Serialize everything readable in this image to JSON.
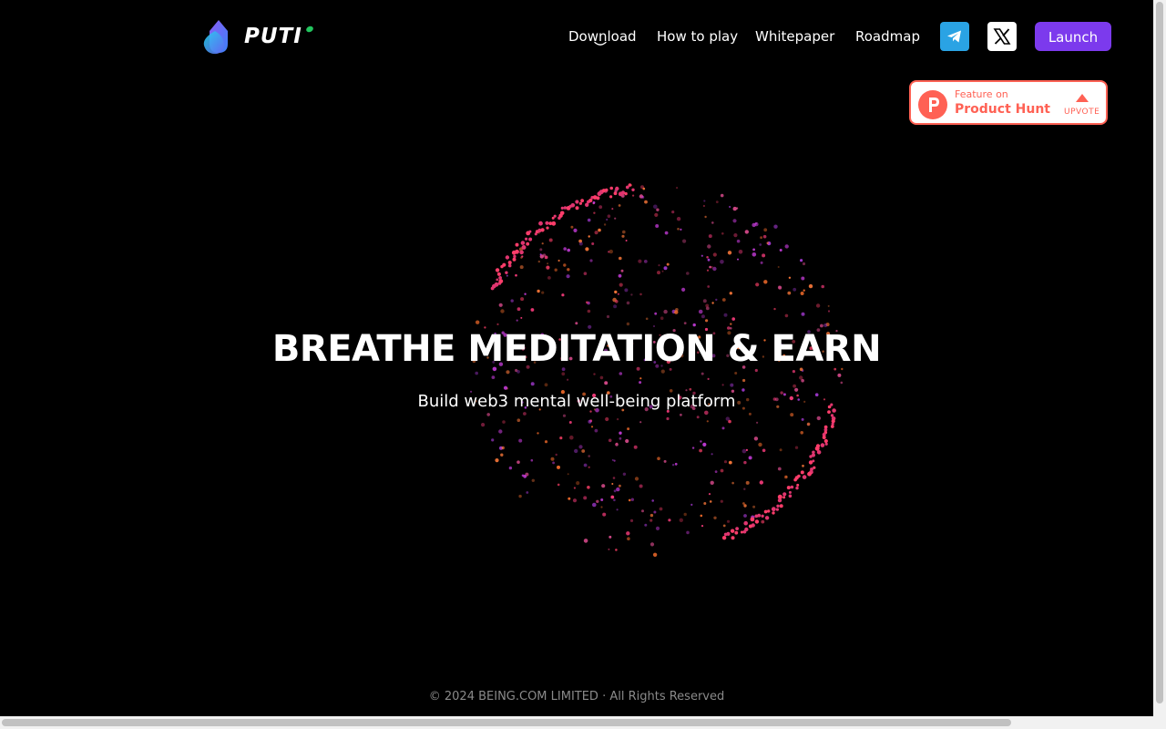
{
  "brand": {
    "name": "PUTI"
  },
  "nav": {
    "items": [
      "Download",
      "How to play",
      "Whitepaper",
      "Roadmap"
    ],
    "launch_label": "Launch",
    "social": [
      "telegram-icon",
      "x-icon"
    ]
  },
  "product_hunt": {
    "small": "Feature on",
    "big": "Product Hunt",
    "upvote": "UPVOTE"
  },
  "hero": {
    "title": "BREATHE MEDITATION & EARN",
    "subtitle": "Build web3 mental well-being platform"
  },
  "footer": {
    "copyright": "© 2024 BEING.COM LIMITED · All Rights Reserved"
  },
  "colors": {
    "background": "#000000",
    "accent": "#7c3aed",
    "telegram": "#2aa3e4",
    "product_hunt": "#ff6154"
  }
}
